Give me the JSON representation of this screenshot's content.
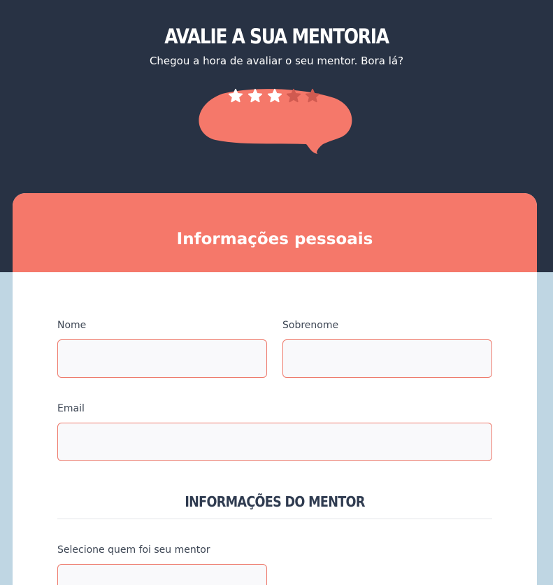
{
  "header": {
    "title": "AVALIE A SUA MENTORIA",
    "subtitle": "Chegou a hora de avaliar o seu mentor. Bora lá?"
  },
  "rating": {
    "value": 3,
    "max": 5,
    "filled_color": "#ffffff",
    "empty_color": "#d05a50",
    "bubble_color": "#f5786a"
  },
  "personal_info": {
    "title": "Informações pessoais",
    "first_name": {
      "label": "Nome",
      "value": "",
      "placeholder": ""
    },
    "last_name": {
      "label": "Sobrenome",
      "value": "",
      "placeholder": ""
    },
    "email": {
      "label": "Email",
      "value": "",
      "placeholder": ""
    }
  },
  "mentor_info": {
    "title": "INFORMAÇÕES DO MENTOR",
    "mentor_select": {
      "label": "Selecione quem foi seu mentor",
      "value": ""
    }
  },
  "colors": {
    "hero_background": "#283244",
    "page_background": "#bfd6e3",
    "accent": "#f5786a",
    "input_border": "#ee7b6d",
    "input_background": "#f9f9fb"
  }
}
